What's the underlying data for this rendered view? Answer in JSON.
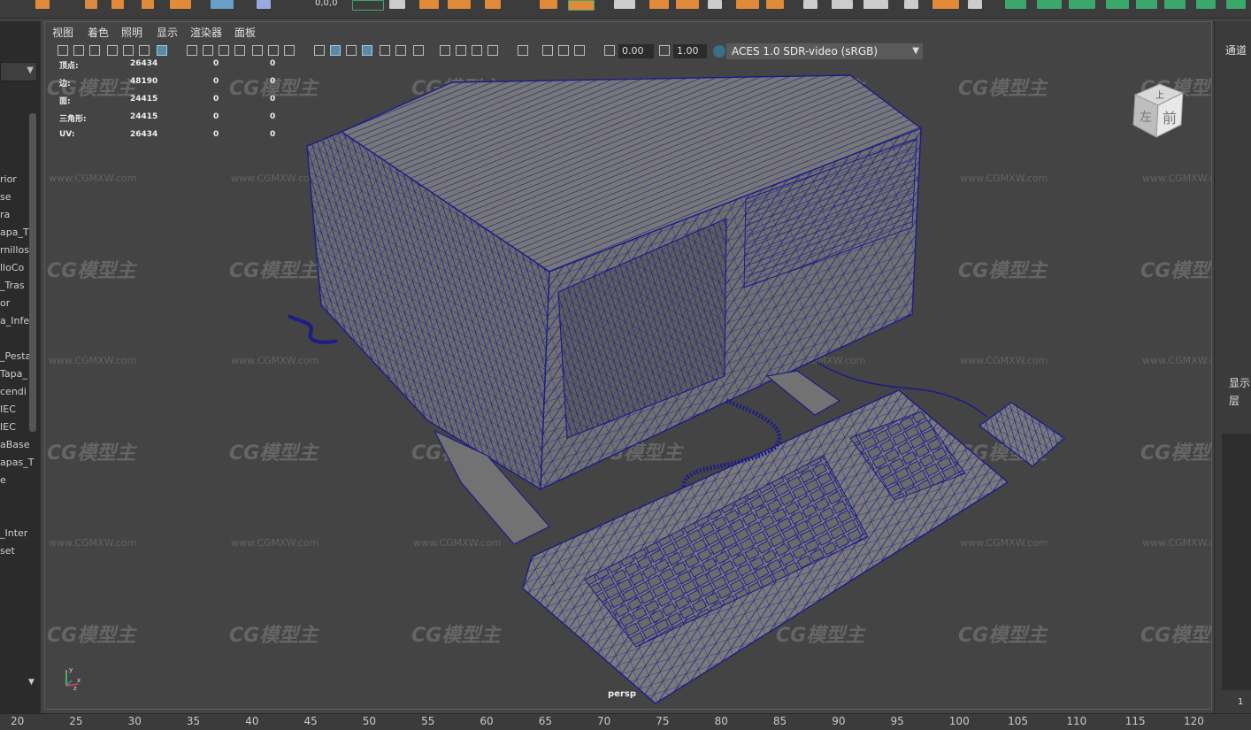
{
  "viewport_menu": [
    "视图",
    "着色",
    "照明",
    "显示",
    "渲染器",
    "面板"
  ],
  "toolbar": {
    "exposure_value": "0.00",
    "gamma_value": "1.00",
    "color_space": "ACES 1.0 SDR-video (sRGB)"
  },
  "shelf_readout": "0,0,0",
  "hud": [
    {
      "label": "顶点:",
      "a": "26434",
      "b": "0",
      "c": "0"
    },
    {
      "label": "边:",
      "a": "48190",
      "b": "0",
      "c": "0"
    },
    {
      "label": "面:",
      "a": "24415",
      "b": "0",
      "c": "0"
    },
    {
      "label": "三角形:",
      "a": "24415",
      "b": "0",
      "c": "0"
    },
    {
      "label": "UV:",
      "a": "26434",
      "b": "0",
      "c": "0"
    }
  ],
  "outliner_items": [
    "rior",
    "se",
    "ra",
    "apa_T",
    "rnillos",
    "lloCo",
    "_Tras",
    "or",
    "a_Infe",
    "_Pesta",
    "Tapa_",
    "cendi",
    "IEC",
    "IEC",
    "aBase",
    "apas_T",
    "e",
    "_Inter",
    "set"
  ],
  "viewcube": {
    "top": "上",
    "front": "前",
    "left": "左"
  },
  "camera_label": "persp",
  "axis": {
    "y": "y",
    "x": "x",
    "z": "z"
  },
  "right_panel": {
    "tab": "通道",
    "display": "显示",
    "layer": "层",
    "scroll_label": "1"
  },
  "watermark": {
    "text": "CG模型主",
    "url": "www.CGMXW.com"
  },
  "timeline_ticks": [
    "20",
    "25",
    "30",
    "35",
    "40",
    "45",
    "50",
    "55",
    "60",
    "65",
    "70",
    "75",
    "80",
    "85",
    "90",
    "95",
    "100",
    "105",
    "110",
    "115",
    "120"
  ],
  "colors": {
    "wireframe": "#1c1c8a",
    "viewport_bg": "#444444",
    "accent": "#e08a3a",
    "shelf_green": "#3aa86b"
  }
}
